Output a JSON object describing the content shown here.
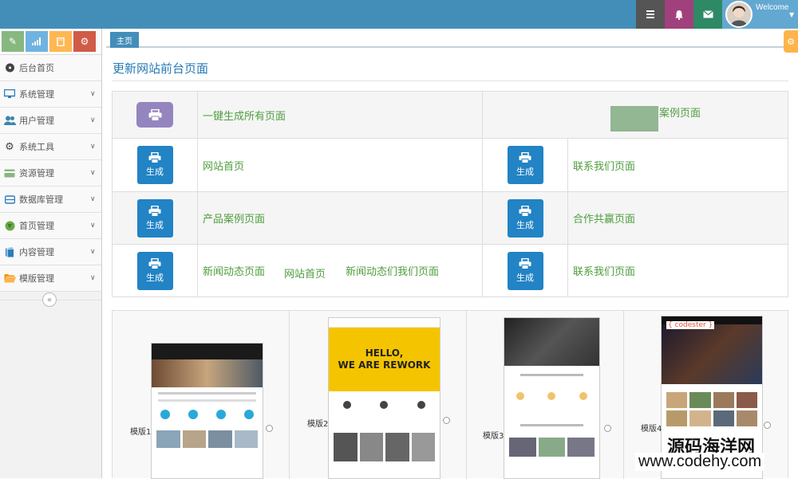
{
  "topbar": {
    "welcome": "Welcome",
    "colors": {
      "bar": "#438eb9",
      "tasks": "#555555",
      "notifications": "#a0407c",
      "messages": "#2e8965",
      "user": "#62a8d1"
    }
  },
  "sidebar": {
    "shortcuts": [
      {
        "icon": "pencil-icon",
        "color": "#87b87f"
      },
      {
        "icon": "signal-icon",
        "color": "#6fb3e0"
      },
      {
        "icon": "book-icon",
        "color": "#ffb752"
      },
      {
        "icon": "cogs-icon",
        "color": "#d15b47"
      }
    ],
    "items": [
      {
        "label": "后台首页",
        "icon": "dashboard-icon",
        "has_caret": false
      },
      {
        "label": "系统管理",
        "icon": "desktop-icon",
        "has_caret": true
      },
      {
        "label": "用户管理",
        "icon": "users-icon",
        "has_caret": true
      },
      {
        "label": "系统工具",
        "icon": "gear-icon",
        "has_caret": true
      },
      {
        "label": "资源管理",
        "icon": "credit-card-icon",
        "has_caret": true
      },
      {
        "label": "数据库管理",
        "icon": "database-icon",
        "has_caret": true
      },
      {
        "label": "首页管理",
        "icon": "globe-icon",
        "has_caret": true
      },
      {
        "label": "内容管理",
        "icon": "book-icon",
        "has_caret": true
      },
      {
        "label": "模版管理",
        "icon": "folder-open-icon",
        "has_caret": true
      }
    ]
  },
  "tabs": {
    "home": "主页"
  },
  "main": {
    "title": "更新网站前台页面",
    "gen_all_label": "一键生成所有页面",
    "gen_button_label": "生成",
    "rows": [
      {
        "left": "网站首页",
        "right": "联系我们页面"
      },
      {
        "left": "产品案例页面",
        "right": "合作共赢页面"
      },
      {
        "left": "新闻动态页面",
        "right": "联系我们页面"
      }
    ],
    "top_right_label": "案例页面",
    "ghost_texts": [
      "网站首页",
      "新闻动态们我们页面"
    ]
  },
  "templates": [
    {
      "label": "模版1",
      "hero": ""
    },
    {
      "label": "模版2",
      "hero": "HELLO,\nWE ARE REWORK"
    },
    {
      "label": "模版3",
      "hero": ""
    },
    {
      "label": "模版4",
      "hero": "{ codester }"
    }
  ],
  "watermark": {
    "line1": "源码海洋网",
    "line2": "www.codehy.com"
  }
}
